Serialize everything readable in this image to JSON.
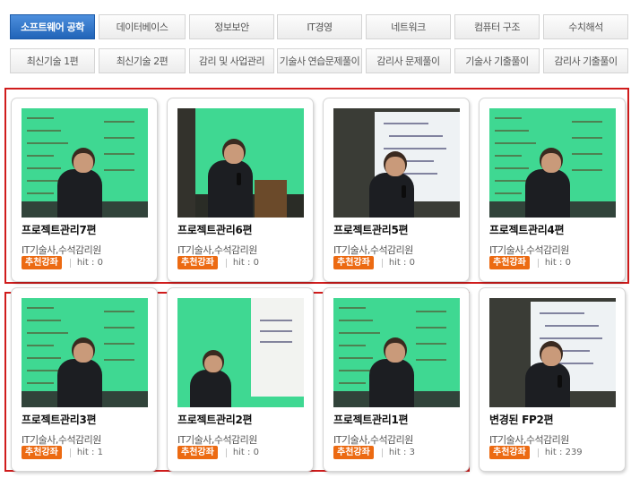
{
  "category_tabs": [
    {
      "label": "소프트웨어 공학",
      "active": true
    },
    {
      "label": "데이터베이스",
      "active": false
    },
    {
      "label": "정보보안",
      "active": false
    },
    {
      "label": "IT경영",
      "active": false
    },
    {
      "label": "네트워크",
      "active": false
    },
    {
      "label": "컴퓨터 구조",
      "active": false
    },
    {
      "label": "수치해석",
      "active": false
    },
    {
      "label": "최신기술 1편",
      "active": false
    },
    {
      "label": "최신기술 2편",
      "active": false
    },
    {
      "label": "감리 및 사업관리",
      "active": false
    },
    {
      "label": "기술사 연습문제풀이",
      "active": false
    },
    {
      "label": "감리사 문제풀이",
      "active": false
    },
    {
      "label": "기술사 기출풀이",
      "active": false
    },
    {
      "label": "감리사 기출풀이",
      "active": false
    }
  ],
  "lectures": [
    {
      "title": "프로젝트관리7편",
      "author": "IT기술사,수석감리원",
      "badge": "추천강좌",
      "hit": "hit : 0",
      "scene": "slides"
    },
    {
      "title": "프로젝트관리6편",
      "author": "IT기술사,수석감리원",
      "badge": "추천강좌",
      "hit": "hit : 0",
      "scene": "podium"
    },
    {
      "title": "프로젝트관리5편",
      "author": "IT기술사,수석감리원",
      "badge": "추천강좌",
      "hit": "hit : 0",
      "scene": "whiteboard"
    },
    {
      "title": "프로젝트관리4편",
      "author": "IT기술사,수석감리원",
      "badge": "추천강좌",
      "hit": "hit : 0",
      "scene": "slides"
    },
    {
      "title": "프로젝트관리3편",
      "author": "IT기술사,수석감리원",
      "badge": "추천강좌",
      "hit": "hit : 1",
      "scene": "slides"
    },
    {
      "title": "프로젝트관리2편",
      "author": "IT기술사,수석감리원",
      "badge": "추천강좌",
      "hit": "hit : 0",
      "scene": "writing"
    },
    {
      "title": "프로젝트관리1편",
      "author": "IT기술사,수석감리원",
      "badge": "추천강좌",
      "hit": "hit : 3",
      "scene": "slides"
    },
    {
      "title": "변경된 FP2편",
      "author": "IT기술사,수석감리원",
      "badge": "추천강좌",
      "hit": "hit : 239",
      "scene": "whiteboard"
    }
  ],
  "colors": {
    "active_tab": "#2a6fc4",
    "selection_border": "#d01c1c",
    "badge": "#ec6a12",
    "slide_green": "#3fd892"
  }
}
